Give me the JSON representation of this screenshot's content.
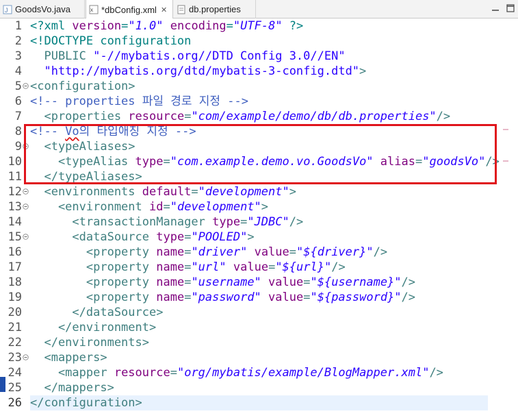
{
  "tabs": [
    {
      "label": "GoodsVo.java",
      "icon": "java-file-icon",
      "active": false
    },
    {
      "label": "*dbConfig.xml",
      "icon": "xml-file-icon",
      "active": true,
      "close": "✕"
    },
    {
      "label": "db.properties",
      "icon": "properties-file-icon",
      "active": false
    }
  ],
  "editor": {
    "current_line": 26,
    "lines": [
      {
        "n": "1",
        "parts": [
          [
            "decl",
            "<?xml "
          ],
          [
            "attr",
            "version"
          ],
          [
            "decl",
            "="
          ],
          [
            "val",
            "\"1.0\""
          ],
          [
            "decl",
            " "
          ],
          [
            "attr",
            "encoding"
          ],
          [
            "decl",
            "="
          ],
          [
            "val",
            "\"UTF-8\""
          ],
          [
            "decl",
            " ?>"
          ]
        ]
      },
      {
        "n": "2",
        "parts": [
          [
            "decl",
            "<!DOCTYPE configuration"
          ]
        ]
      },
      {
        "n": "3",
        "parts": [
          [
            "dt",
            "  PUBLIC "
          ],
          [
            "str",
            "\"-//mybatis.org//DTD Config 3.0//EN\""
          ]
        ]
      },
      {
        "n": "4",
        "parts": [
          [
            "str",
            "  \"http://mybatis.org/dtd/mybatis-3-config.dtd\""
          ],
          [
            "dt",
            ">"
          ]
        ]
      },
      {
        "n": "5",
        "fold": true,
        "parts": [
          [
            "tag",
            "<configuration>"
          ]
        ]
      },
      {
        "n": "6",
        "parts": [
          [
            "com",
            "<!-- properties 파일 경로 지정 -->"
          ]
        ]
      },
      {
        "n": "7",
        "parts": [
          [
            "tag",
            "  <properties "
          ],
          [
            "attr",
            "resource"
          ],
          [
            "tag",
            "="
          ],
          [
            "val",
            "\"com/example/demo/db/db.properties\""
          ],
          [
            "tag",
            "/>"
          ]
        ]
      },
      {
        "n": "8",
        "parts": [
          [
            "com",
            "<!-- "
          ],
          [
            "comsq",
            "Vo"
          ],
          [
            "com",
            "의 타입애칭 지정 -->"
          ]
        ]
      },
      {
        "n": "9",
        "fold": true,
        "parts": [
          [
            "tag",
            "  <typeAliases>"
          ]
        ]
      },
      {
        "n": "10",
        "parts": [
          [
            "tag",
            "    <typeAlias "
          ],
          [
            "attr",
            "type"
          ],
          [
            "tag",
            "="
          ],
          [
            "val",
            "\"com.example.demo.vo.GoodsVo\""
          ],
          [
            "tag",
            " "
          ],
          [
            "attr",
            "alias"
          ],
          [
            "tag",
            "="
          ],
          [
            "val",
            "\"goodsVo\""
          ],
          [
            "tag",
            "/>"
          ]
        ]
      },
      {
        "n": "11",
        "parts": [
          [
            "tag",
            "  </typeAliases>"
          ]
        ]
      },
      {
        "n": "12",
        "fold": true,
        "parts": [
          [
            "tag",
            "  <environments "
          ],
          [
            "attr",
            "default"
          ],
          [
            "tag",
            "="
          ],
          [
            "val",
            "\"development\""
          ],
          [
            "tag",
            ">"
          ]
        ]
      },
      {
        "n": "13",
        "fold": true,
        "parts": [
          [
            "tag",
            "    <environment "
          ],
          [
            "attr",
            "id"
          ],
          [
            "tag",
            "="
          ],
          [
            "val",
            "\"development\""
          ],
          [
            "tag",
            ">"
          ]
        ]
      },
      {
        "n": "14",
        "parts": [
          [
            "tag",
            "      <transactionManager "
          ],
          [
            "attr",
            "type"
          ],
          [
            "tag",
            "="
          ],
          [
            "val",
            "\"JDBC\""
          ],
          [
            "tag",
            "/>"
          ]
        ]
      },
      {
        "n": "15",
        "fold": true,
        "parts": [
          [
            "tag",
            "      <dataSource "
          ],
          [
            "attr",
            "type"
          ],
          [
            "tag",
            "="
          ],
          [
            "val",
            "\"POOLED\""
          ],
          [
            "tag",
            ">"
          ]
        ]
      },
      {
        "n": "16",
        "parts": [
          [
            "tag",
            "        <property "
          ],
          [
            "attr",
            "name"
          ],
          [
            "tag",
            "="
          ],
          [
            "val",
            "\"driver\""
          ],
          [
            "tag",
            " "
          ],
          [
            "attr",
            "value"
          ],
          [
            "tag",
            "="
          ],
          [
            "val",
            "\"${driver}\""
          ],
          [
            "tag",
            "/>"
          ]
        ]
      },
      {
        "n": "17",
        "parts": [
          [
            "tag",
            "        <property "
          ],
          [
            "attr",
            "name"
          ],
          [
            "tag",
            "="
          ],
          [
            "val",
            "\"url\""
          ],
          [
            "tag",
            " "
          ],
          [
            "attr",
            "value"
          ],
          [
            "tag",
            "="
          ],
          [
            "val",
            "\"${url}\""
          ],
          [
            "tag",
            "/>"
          ]
        ]
      },
      {
        "n": "18",
        "parts": [
          [
            "tag",
            "        <property "
          ],
          [
            "attr",
            "name"
          ],
          [
            "tag",
            "="
          ],
          [
            "val",
            "\"username\""
          ],
          [
            "tag",
            " "
          ],
          [
            "attr",
            "value"
          ],
          [
            "tag",
            "="
          ],
          [
            "val",
            "\"${username}\""
          ],
          [
            "tag",
            "/>"
          ]
        ]
      },
      {
        "n": "19",
        "parts": [
          [
            "tag",
            "        <property "
          ],
          [
            "attr",
            "name"
          ],
          [
            "tag",
            "="
          ],
          [
            "val",
            "\"password\""
          ],
          [
            "tag",
            " "
          ],
          [
            "attr",
            "value"
          ],
          [
            "tag",
            "="
          ],
          [
            "val",
            "\"${password}\""
          ],
          [
            "tag",
            "/>"
          ]
        ]
      },
      {
        "n": "20",
        "parts": [
          [
            "tag",
            "      </dataSource>"
          ]
        ]
      },
      {
        "n": "21",
        "parts": [
          [
            "tag",
            "    </environment>"
          ]
        ]
      },
      {
        "n": "22",
        "parts": [
          [
            "tag",
            "  </environments>"
          ]
        ]
      },
      {
        "n": "23",
        "fold": true,
        "parts": [
          [
            "tag",
            "  <mappers>"
          ]
        ]
      },
      {
        "n": "24",
        "parts": [
          [
            "tag",
            "    <mapper "
          ],
          [
            "attr",
            "resource"
          ],
          [
            "tag",
            "="
          ],
          [
            "val",
            "\"org/mybatis/example/BlogMapper.xml\""
          ],
          [
            "tag",
            "/>"
          ]
        ]
      },
      {
        "n": "25",
        "parts": [
          [
            "tag",
            "  </mappers>"
          ]
        ]
      },
      {
        "n": "26",
        "parts": [
          [
            "tag",
            "</configuration>"
          ]
        ]
      }
    ]
  },
  "colors": {
    "highlight_box": "#e0141c",
    "current_line": "#e8f2fe"
  }
}
